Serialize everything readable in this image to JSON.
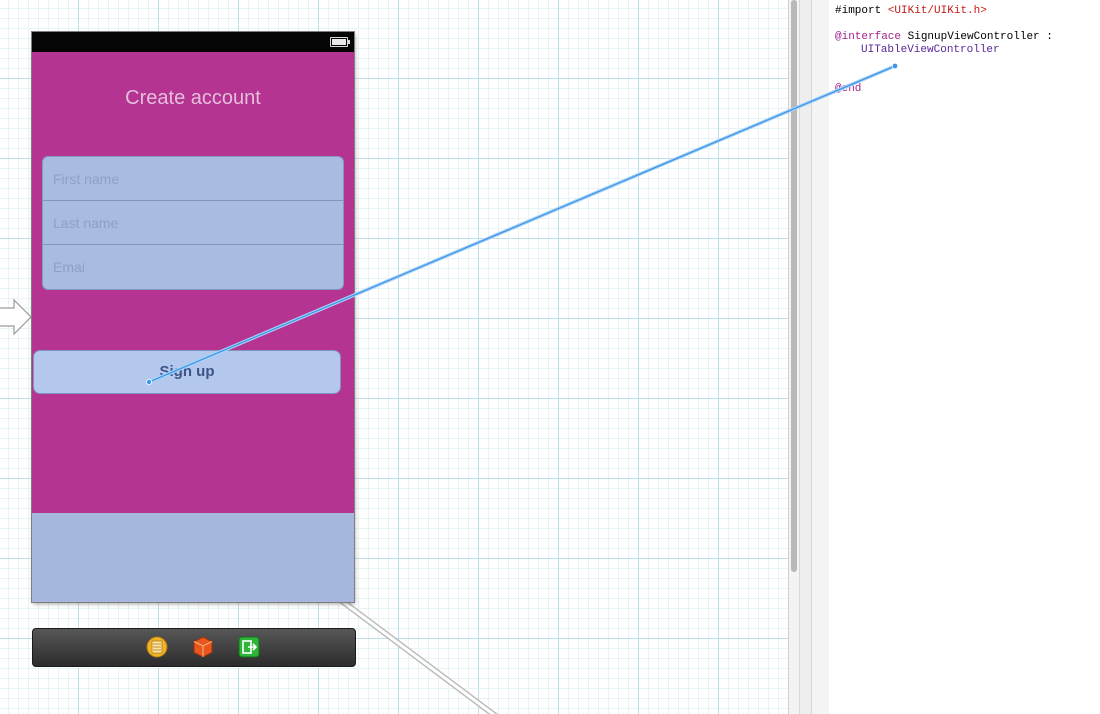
{
  "scene": {
    "title": "Create account",
    "fields": [
      {
        "placeholder": "First name"
      },
      {
        "placeholder": "Last name"
      },
      {
        "placeholder": "Emai"
      }
    ],
    "signup_label": "Sign up",
    "colors": {
      "background": "#b53391",
      "field_bg": "#a8bbe0",
      "button_bg": "#b4c7ec",
      "connection_line": "#4aa0ee"
    }
  },
  "dock": {
    "icons": [
      "first-responder-icon",
      "view-controller-icon",
      "exit-icon"
    ]
  },
  "editor": {
    "import_directive": "#import",
    "import_target": "<UIKit/UIKit.h>",
    "interface_keyword": "@interface",
    "class_name": "SignupViewController",
    "colon": ":",
    "superclass": "UITableViewController",
    "end_keyword": "@end"
  }
}
